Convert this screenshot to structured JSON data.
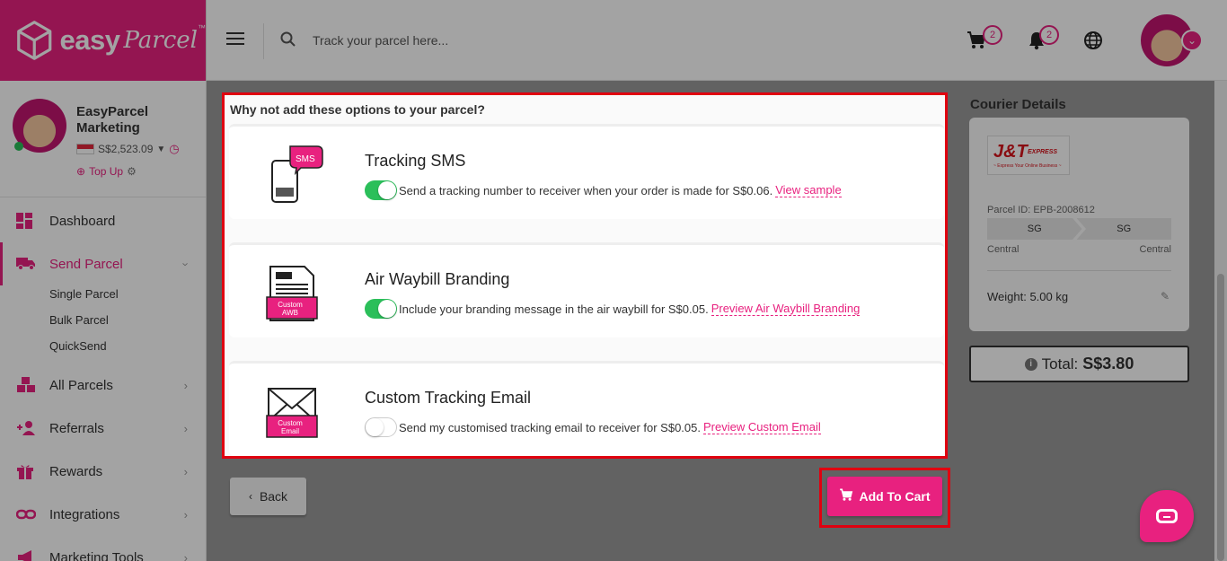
{
  "brand": {
    "logo_text": "easy",
    "logo_script": "Parcel",
    "tm": "™"
  },
  "header": {
    "search_placeholder": "Track your parcel here...",
    "cart_count": "2",
    "notification_count": "2"
  },
  "profile": {
    "name": "EasyParcel Marketing",
    "balance": "S$2,523.09",
    "topup_label": "Top Up"
  },
  "sidebar": {
    "items": [
      {
        "label": "Dashboard"
      },
      {
        "label": "Send Parcel"
      },
      {
        "label": "All Parcels"
      },
      {
        "label": "Referrals"
      },
      {
        "label": "Rewards"
      },
      {
        "label": "Integrations"
      },
      {
        "label": "Marketing Tools"
      }
    ],
    "send_parcel_sub": [
      "Single Parcel",
      "Bulk Parcel",
      "QuickSend"
    ]
  },
  "options": {
    "title": "Why not add these options to your parcel?",
    "items": [
      {
        "title": "Tracking SMS",
        "enabled": true,
        "description": "Send a tracking number to receiver when your order is made for S$0.06.",
        "link": "View sample",
        "icon": "sms-phone-icon",
        "icon_text": "SMS"
      },
      {
        "title": "Air Waybill Branding",
        "enabled": true,
        "description": "Include your branding message in the air waybill for S$0.05.",
        "link": "Preview Air Waybill Branding",
        "icon": "custom-awb-icon",
        "icon_text": "Custom AWB"
      },
      {
        "title": "Custom Tracking Email",
        "enabled": false,
        "description": "Send my customised tracking email to receiver for S$0.05.",
        "link": "Preview Custom Email",
        "icon": "custom-email-icon",
        "icon_text": "Custom Email"
      }
    ]
  },
  "actions": {
    "back_label": "Back",
    "add_to_cart_label": "Add To Cart"
  },
  "courier": {
    "title": "Courier Details",
    "logo_main": "J&T",
    "logo_sub": "EXPRESS",
    "logo_tagline": "~ Express Your Online Business ~",
    "parcel_id": "Parcel ID: EPB-2008612",
    "from_country": "SG",
    "to_country": "SG",
    "from_region": "Central",
    "to_region": "Central",
    "weight": "Weight: 5.00 kg",
    "total_label": "Total:",
    "total_value": "S$3.80"
  },
  "colors": {
    "brand": "#e8217f",
    "toggle_on": "#2bbf5a",
    "highlight": "#e00010"
  }
}
